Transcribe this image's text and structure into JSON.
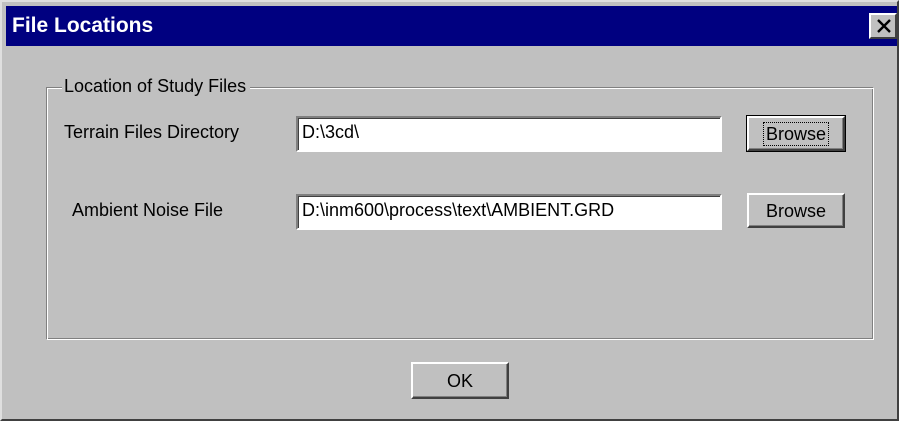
{
  "window": {
    "title": "File Locations"
  },
  "group": {
    "legend": "Location of Study Files"
  },
  "fields": {
    "terrain": {
      "label": "Terrain Files Directory",
      "value": "D:\\3cd\\",
      "browse_label": "Browse"
    },
    "ambient": {
      "label": "Ambient Noise File",
      "value": "D:\\inm600\\process\\text\\AMBIENT.GRD",
      "browse_label": "Browse"
    }
  },
  "footer": {
    "ok_label": "OK"
  },
  "colors": {
    "titlebar": "#000080",
    "face": "#c0c0c0"
  },
  "icons": {
    "close": "close-icon"
  }
}
